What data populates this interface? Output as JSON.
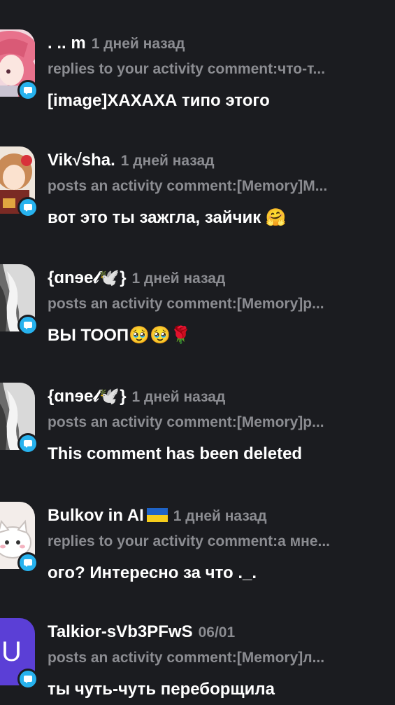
{
  "notifications": [
    {
      "username": ". .. m",
      "time": "1 дней назад",
      "action": "replies to your activity comment:что-т...",
      "message": "[image]ХАХАХА типо этого",
      "avatar": "anime-girl-pink-hair-avatar"
    },
    {
      "username": "Vik√sha.",
      "time": "1 дней назад",
      "action": "posts an activity comment:[Memory]М...",
      "message": "вот это ты зажгла, зайчик 🤗",
      "avatar": "anime-character-avatar"
    },
    {
      "username": "{ɑnɘe𝓁🕊️}",
      "time": "1 дней назад",
      "action": "posts an activity comment:[Memory]р...",
      "message": "ВЫ ТООП🥹🥹🌹",
      "avatar": "monochrome-art-avatar"
    },
    {
      "username": "{ɑnɘe𝓁🕊️}",
      "time": "1 дней назад",
      "action": "posts an activity comment:[Memory]р...",
      "message": "This comment has been deleted",
      "avatar": "monochrome-art-avatar"
    },
    {
      "username": "Bulkov in AI",
      "flag": "ukraine-flag",
      "time": "1 дней назад",
      "action": "replies to your activity comment:а мне...",
      "message": "ого? Интересно за что ._.",
      "avatar": "cat-sticker-avatar"
    },
    {
      "username": "Talkior-sVb3PFwS",
      "time": "06/01",
      "action": "posts an activity comment:[Memory]л...",
      "message": "ты чуть-чуть переборщила",
      "avatar": "letter-avatar",
      "avatar_letter": "U"
    }
  ],
  "colors": {
    "background": "#1b1c20",
    "muted_text": "#8b8c91",
    "badge_blue": "#27b2ee",
    "letter_avatar": "#5b3fd6"
  }
}
